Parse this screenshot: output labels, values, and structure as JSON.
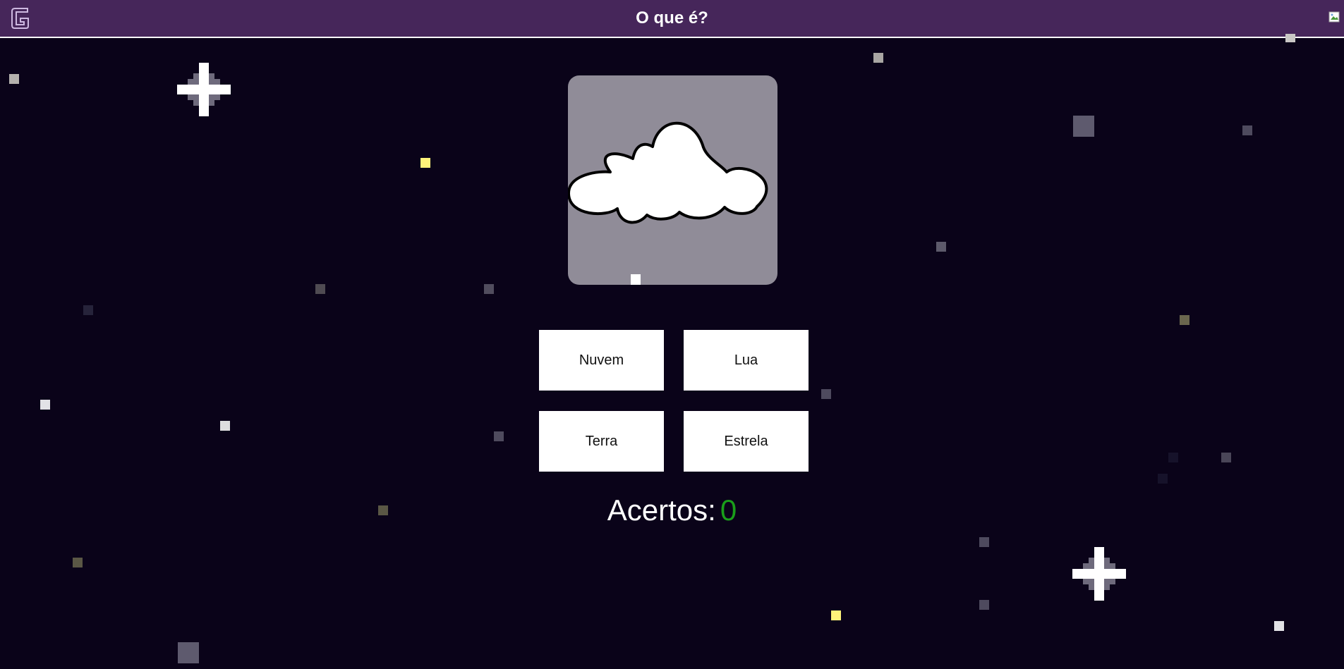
{
  "header": {
    "title": "O que é?",
    "logo_icon": "letter-g-logo-icon",
    "top_right_icon": "broken-image-icon",
    "background_color": "#46265a"
  },
  "question": {
    "image_icon": "cloud-icon",
    "card_color": "#908c98"
  },
  "answers": [
    {
      "label": "Nuvem"
    },
    {
      "label": "Lua"
    },
    {
      "label": "Terra"
    },
    {
      "label": "Estrela"
    }
  ],
  "score": {
    "label": "Acertos:",
    "value": "0",
    "value_color": "#1a9e1a"
  },
  "background": {
    "color": "#0a0319",
    "decoration_icons": [
      "star-pixel-icon",
      "sparkle-icon"
    ]
  }
}
